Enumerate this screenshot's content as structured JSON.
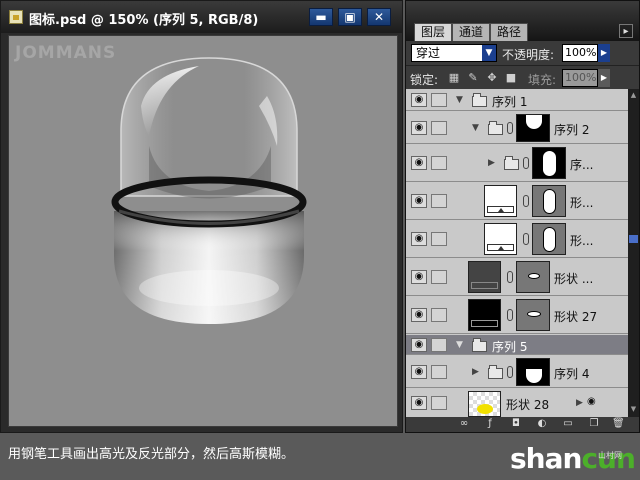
{
  "document": {
    "title": "图标.psd @ 150% (序列 5, RGB/8)",
    "watermark": "JOMMANS",
    "buttons": {
      "minimize": "▬",
      "maximize": "▣",
      "close": "✕"
    }
  },
  "layers_panel": {
    "tabs": [
      "图层",
      "通道",
      "路径"
    ],
    "active_tab": "图层",
    "blend_mode": "穿过",
    "opacity_label": "不透明度:",
    "opacity_value": "100%",
    "lock_label": "锁定:",
    "fill_label": "填充:",
    "fill_value": "100%",
    "layers": [
      {
        "name": "序列 1",
        "type": "group",
        "expanded": true,
        "selected": false
      },
      {
        "name": "序列 2",
        "type": "group",
        "expanded": true,
        "selected": false
      },
      {
        "name": "序...",
        "type": "group",
        "expanded": false,
        "selected": false
      },
      {
        "name": "形...",
        "type": "shape",
        "selected": false
      },
      {
        "name": "形...",
        "type": "shape",
        "selected": false
      },
      {
        "name": "形状 ...",
        "type": "shape",
        "selected": false
      },
      {
        "name": "形状 27",
        "type": "shape",
        "selected": false
      },
      {
        "name": "序列 5",
        "type": "group",
        "expanded": true,
        "selected": true
      },
      {
        "name": "序列 4",
        "type": "group",
        "expanded": false,
        "selected": false
      },
      {
        "name": "形状 28",
        "type": "shape",
        "selected": false
      }
    ]
  },
  "caption": "用钢笔工具画出高光及反光部分，然后高斯模糊。",
  "site_logo": {
    "part1": "shan",
    "part2": "cun",
    "sub": "山村网"
  },
  "colors": {
    "canvas": "#8e8e8e",
    "selected_layer": "#7d7d85",
    "accent": "#1b3f8f",
    "logo_green": "#4caf2a"
  }
}
